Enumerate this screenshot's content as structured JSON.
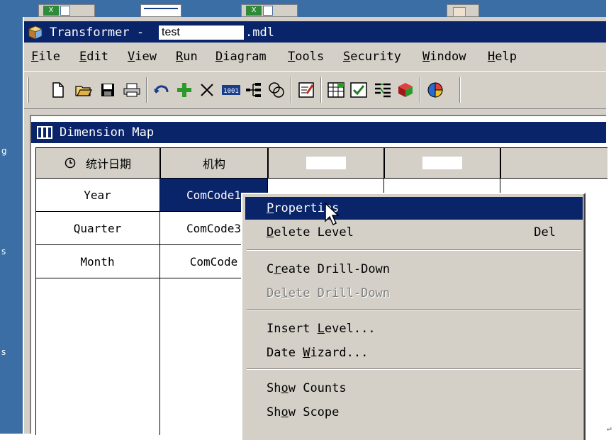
{
  "desktop": {
    "left_fragments": [
      "g",
      "s",
      "s"
    ]
  },
  "window": {
    "title_prefix": "Transformer -",
    "title_file": "test",
    "title_suffix": ".mdl"
  },
  "menubar": {
    "items": [
      {
        "label": "File",
        "mnemonic": "F"
      },
      {
        "label": "Edit",
        "mnemonic": "E"
      },
      {
        "label": "View",
        "mnemonic": "V"
      },
      {
        "label": "Run",
        "mnemonic": "R"
      },
      {
        "label": "Diagram",
        "mnemonic": "D"
      },
      {
        "label": "Tools",
        "mnemonic": "T"
      },
      {
        "label": "Security",
        "mnemonic": "S"
      },
      {
        "label": "Window",
        "mnemonic": "W"
      },
      {
        "label": "Help",
        "mnemonic": "H"
      }
    ]
  },
  "toolbar": {
    "buttons": [
      "new-icon",
      "open-icon",
      "save-icon",
      "print-icon",
      "undo-icon",
      "add-icon",
      "delete-icon",
      "counts-icon",
      "tree-icon",
      "link-icon",
      "properties-icon",
      "grid-icon",
      "check-icon",
      "dimension-icon",
      "cube-icon",
      "pie-chart-icon"
    ]
  },
  "dimension_map": {
    "title": "Dimension Map",
    "headers": [
      "统计日期",
      "机构",
      "",
      ""
    ],
    "rows": [
      [
        "Year",
        "ComCode1"
      ],
      [
        "Quarter",
        "ComCode3"
      ],
      [
        "Month",
        "ComCode"
      ]
    ]
  },
  "context_menu": {
    "items": [
      {
        "label": "Properties",
        "mnemonic": "P",
        "shortcut": "",
        "highlighted": true,
        "disabled": false
      },
      {
        "label": "Delete Level",
        "mnemonic": "D",
        "shortcut": "Del",
        "highlighted": false,
        "disabled": false
      },
      {
        "label": "Create Drill-Down",
        "mnemonic": "r",
        "shortcut": "",
        "highlighted": false,
        "disabled": false
      },
      {
        "label": "Delete Drill-Down",
        "mnemonic": "l",
        "shortcut": "",
        "highlighted": false,
        "disabled": true
      },
      {
        "label": "Insert Level...",
        "mnemonic": "L",
        "shortcut": "",
        "highlighted": false,
        "disabled": false
      },
      {
        "label": "Date Wizard...",
        "mnemonic": "W",
        "shortcut": "",
        "highlighted": false,
        "disabled": false
      },
      {
        "label": "Show Counts",
        "mnemonic": "o",
        "shortcut": "",
        "highlighted": false,
        "disabled": false
      },
      {
        "label": "Show Scope",
        "mnemonic": "o",
        "shortcut": "",
        "highlighted": false,
        "disabled": false
      }
    ]
  },
  "colors": {
    "titlebar": "#0a246a",
    "face": "#d4d0c8",
    "desktop": "#3a6ea5"
  }
}
